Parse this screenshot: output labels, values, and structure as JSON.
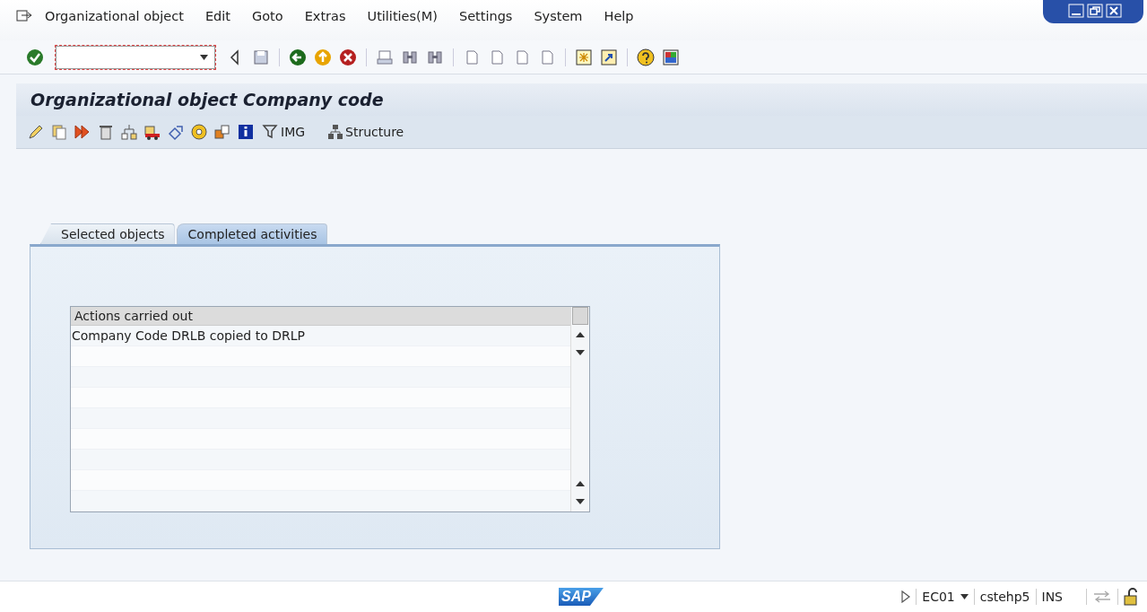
{
  "menu_bar": {
    "items": [
      "Organizational object",
      "Edit",
      "Goto",
      "Extras",
      "Utilities(M)",
      "Settings",
      "System",
      "Help"
    ]
  },
  "title": "Organizational object Company code",
  "app_toolbar": {
    "text_buttons": [
      "IMG",
      "Structure"
    ]
  },
  "tabs": [
    {
      "label": "Selected objects",
      "selected": false
    },
    {
      "label": "Completed activities",
      "selected": true
    }
  ],
  "table": {
    "columns": [
      "Actions carried out"
    ],
    "rows": [
      "Company Code DRLB copied to DRLP"
    ]
  },
  "status_bar": {
    "logo": "SAP",
    "system": "EC01",
    "server": "cstehp5",
    "mode": "INS"
  }
}
